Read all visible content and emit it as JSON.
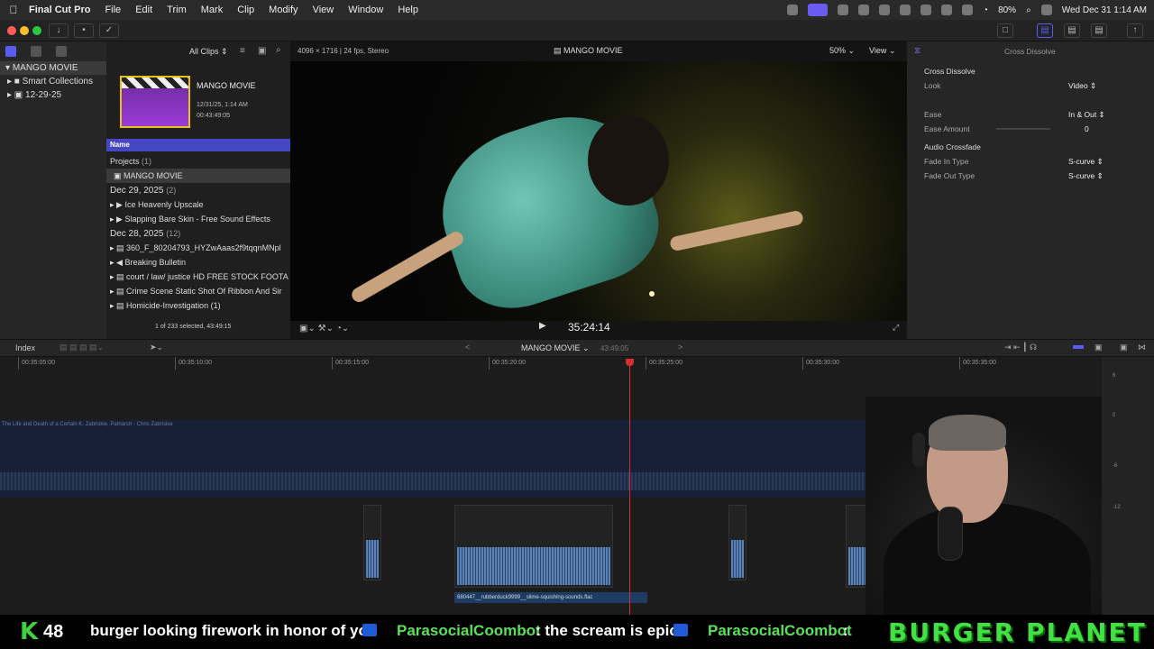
{
  "menubar": {
    "app": "Final Cut Pro",
    "items": [
      "File",
      "Edit",
      "Trim",
      "Mark",
      "Clip",
      "Modify",
      "View",
      "Window",
      "Help"
    ],
    "battery": "80%",
    "clock": "Wed Dec 31  1:14 AM"
  },
  "library": {
    "items": [
      {
        "label": "MANGO MOVIE"
      },
      {
        "label": "Smart Collections"
      },
      {
        "label": "12-29-25"
      }
    ]
  },
  "browser": {
    "filter": "All Clips",
    "clip": {
      "title": "MANGO MOVIE",
      "date": "12/31/25, 1:14 AM",
      "duration": "00:43:49:05"
    },
    "column_header": "Name",
    "rows": [
      {
        "label": "Projects",
        "count": "(1)"
      },
      {
        "label": "MANGO MOVIE"
      },
      {
        "label": "Dec 29, 2025",
        "count": "(2)"
      },
      {
        "label": "Ice Heavenly Upscale"
      },
      {
        "label": "Slapping Bare Skin - Free Sound Effects"
      },
      {
        "label": "Dec 28, 2025",
        "count": "(12)"
      },
      {
        "label": "360_F_80204793_HYZwAaas2f9tqqnMNpl"
      },
      {
        "label": "Breaking Bulletin"
      },
      {
        "label": "court / law/ justice HD FREE STOCK FOOTA"
      },
      {
        "label": "Crime Scene Static Shot Of Ribbon And Sir"
      },
      {
        "label": "Homicide-Investigation (1)"
      }
    ],
    "selection": "1 of 233 selected, 43:49:15"
  },
  "viewer": {
    "format": "4096 × 1716 | 24 fps, Stereo",
    "title": "MANGO MOVIE",
    "zoom": "50%",
    "view_label": "View",
    "timecode": "35:24:14"
  },
  "inspector": {
    "tab_title": "Cross Dissolve",
    "section_title": "Cross Dissolve",
    "look_label": "Look",
    "look_value": "Video",
    "ease_label": "Ease",
    "ease_value": "In & Out",
    "ease_amount_label": "Ease Amount",
    "ease_amount_value": "0",
    "audio_section": "Audio Crossfade",
    "fade_in_label": "Fade In Type",
    "fade_in_value": "S-curve",
    "fade_out_label": "Fade Out Type",
    "fade_out_value": "S-curve"
  },
  "timeline": {
    "index_label": "Index",
    "project": "MANGO MOVIE",
    "duration": "43:49:05",
    "ruler": [
      "00:35:05:00",
      "00:35:10:00",
      "00:35:15:00",
      "00:35:20:00",
      "00:35:25:00",
      "00:35:30:00",
      "00:35:35:00"
    ],
    "music_clip": "The Life and Death of a Certain K. Zabriskie, Patriarch - Chris Zabriskie",
    "audio_clip_label": "680447__rubberduck9999__slime-squishing-sounds.flac",
    "meter_labels": [
      "6",
      "0",
      "-6",
      "-12"
    ]
  },
  "ticker": {
    "k_letter": "K",
    "count": "48",
    "messages": [
      "burger looking firework in honor of you",
      "ParasocialCoombot",
      ": the scream is epic",
      "ParasocialCoombot",
      ":"
    ],
    "brand": "BURGER PLANET"
  },
  "colors": {
    "accent": "#5a5cf0",
    "playhead": "#d03030",
    "ticker_green": "#43e043"
  }
}
